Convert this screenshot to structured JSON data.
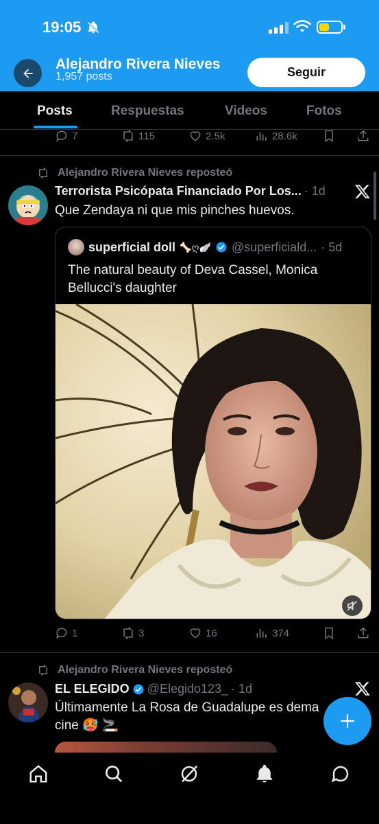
{
  "status_bar": {
    "time": "19:05"
  },
  "header": {
    "profile_name": "Alejandro Rivera Nieves",
    "posts_count": "1,957 posts",
    "follow_label": "Seguir"
  },
  "tabs": [
    {
      "label": "Posts",
      "active": true
    },
    {
      "label": "Respuestas",
      "active": false
    },
    {
      "label": "Videos",
      "active": false
    },
    {
      "label": "Fotos",
      "active": false
    }
  ],
  "prev_post_actions": {
    "replies": "7",
    "reposts": "115",
    "likes": "2.5k",
    "views": "28.6k"
  },
  "post1": {
    "repost_label": "Alejandro Rivera Nieves reposteó",
    "author": "Terrorista Psicópata Financiado Por Los...",
    "time": "· 1d",
    "text": "Que Zendaya ni que mis pinches huevos.",
    "quote": {
      "author": "superficial doll",
      "author_emoji": "🦴ღ🪽",
      "handle": "@superficiald...",
      "time": "· 5d",
      "text": "The natural beauty of Deva Cassel, Monica Bellucci's daughter"
    },
    "actions": {
      "replies": "1",
      "reposts": "3",
      "likes": "16",
      "views": "374"
    }
  },
  "post2": {
    "repost_label": "Alejandro Rivera Nieves reposteó",
    "author": "EL ELEGIDO",
    "handle": "@Elegido123_",
    "time": "· 1d",
    "text_line1": "Últimamente La Rosa de Guadalupe es dema",
    "text_line2": "cine 🥵 🚬"
  },
  "colors": {
    "accent": "#1d9bf0",
    "background": "#000000",
    "muted": "#71767b",
    "text": "#e7e9ea"
  }
}
